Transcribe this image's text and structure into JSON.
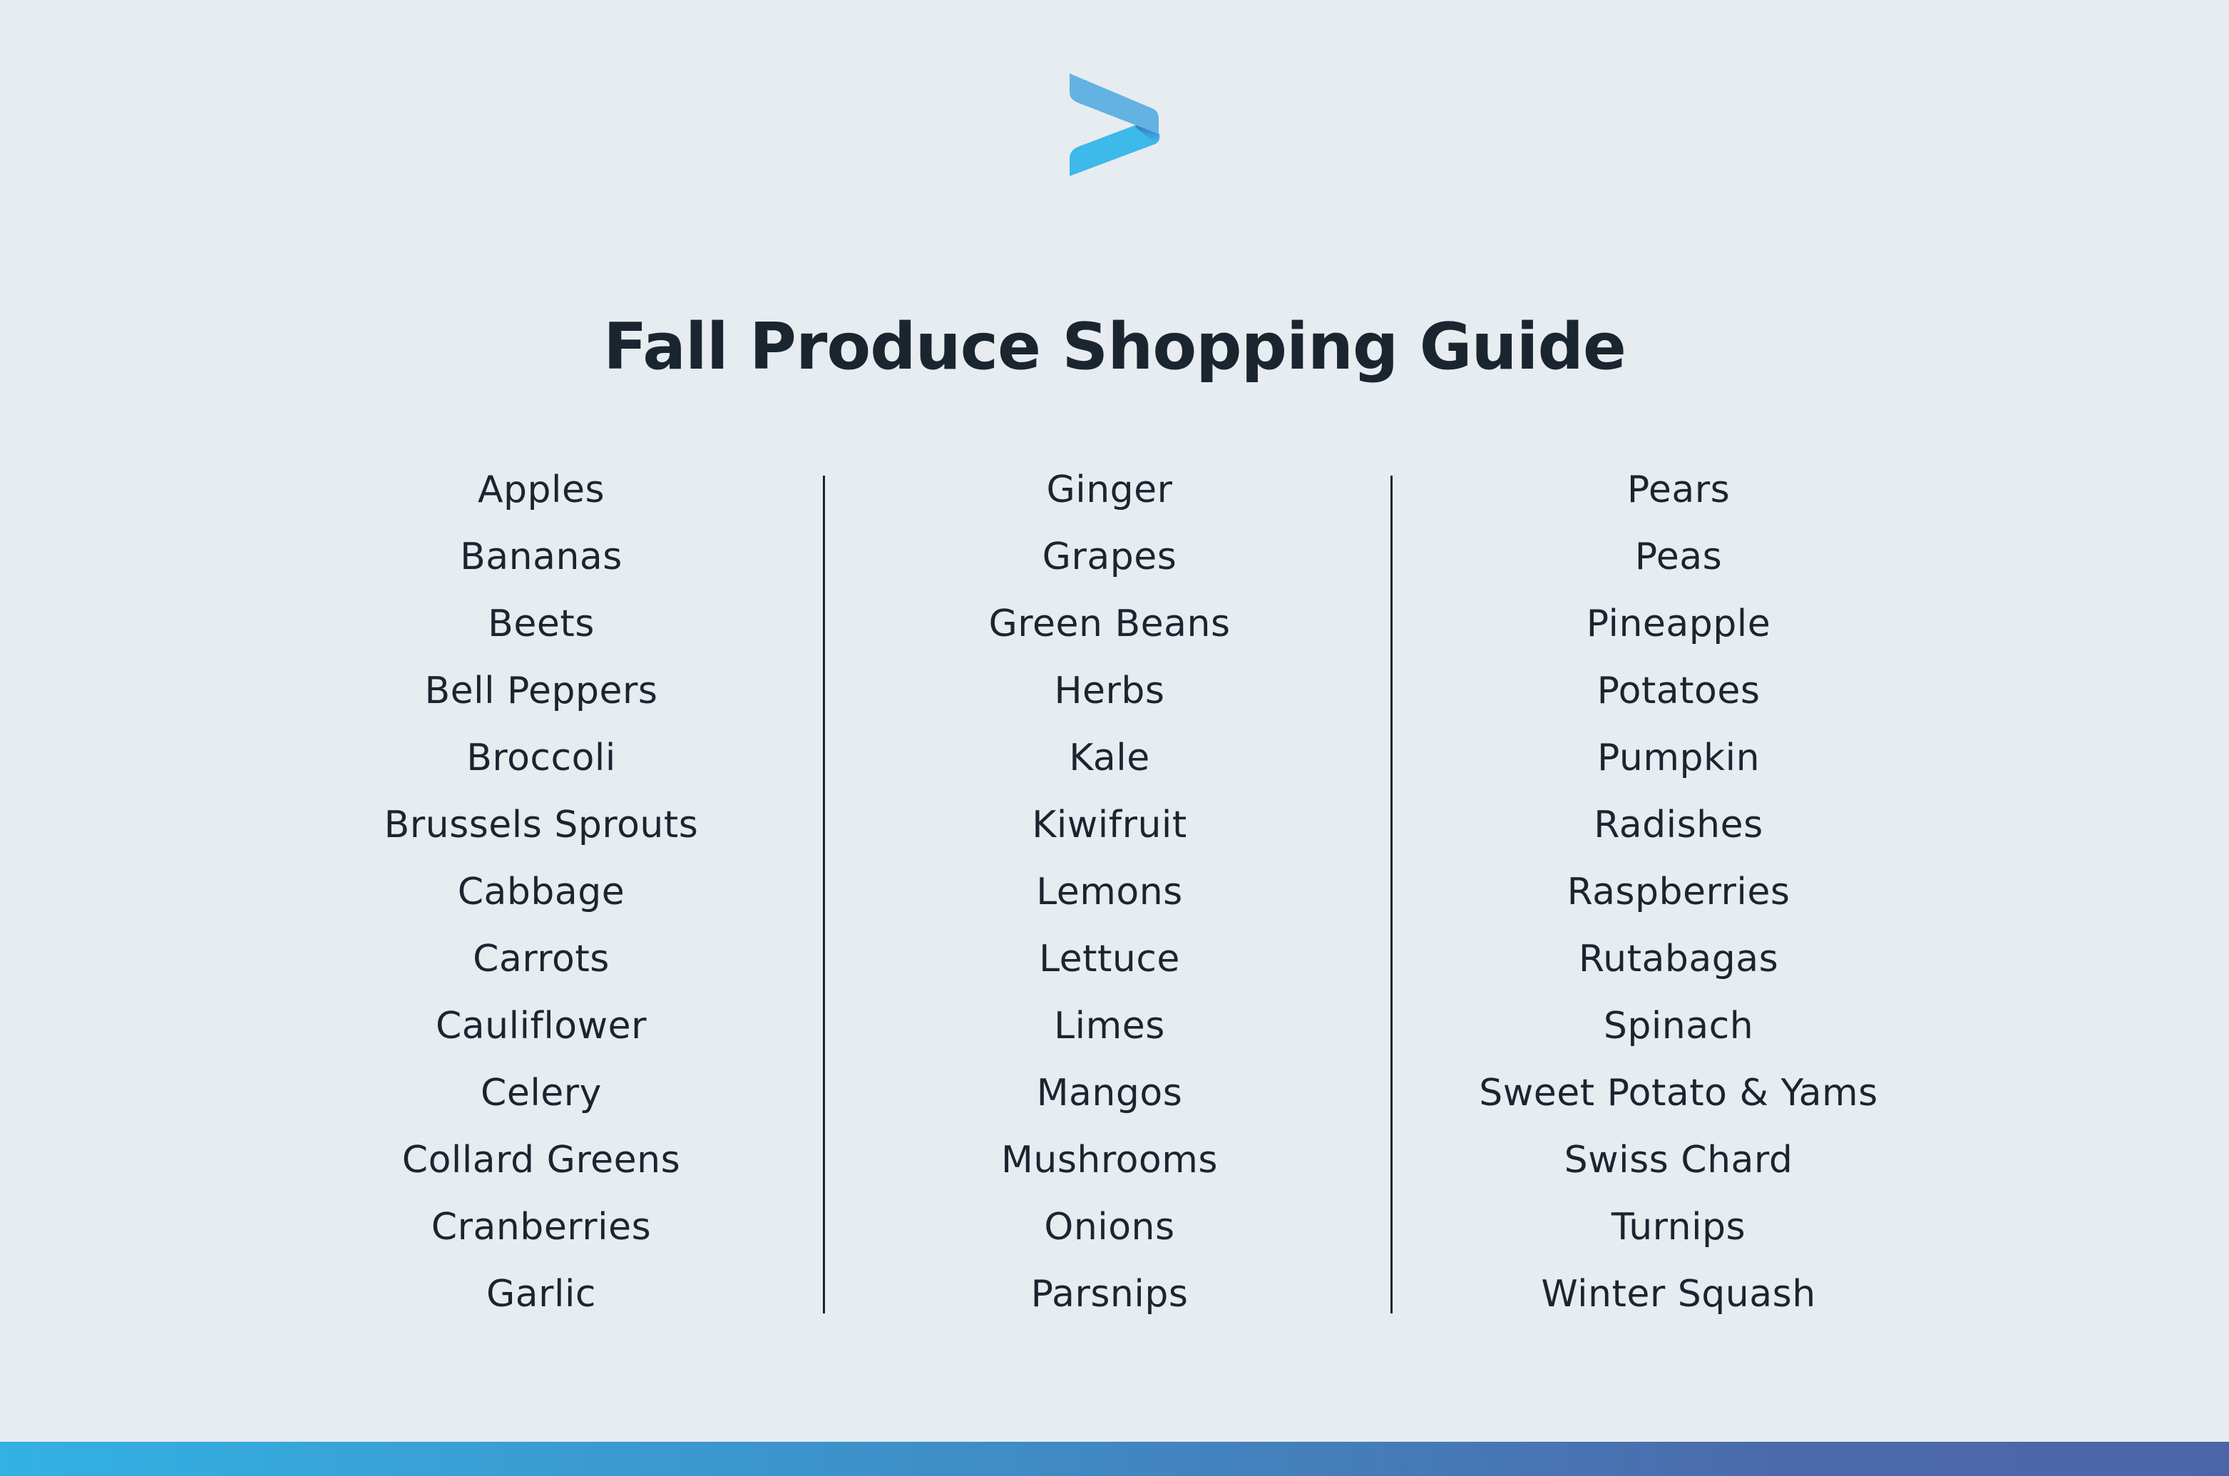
{
  "logo": {
    "icon": "chevron-right-brand-logo",
    "colors": {
      "upper": "#62b3e2",
      "lower": "#3db9ea",
      "fold": "#3a64b8"
    }
  },
  "title": "Fall Produce Shopping Guide",
  "columns": [
    [
      "Apples",
      "Bananas",
      "Beets",
      "Bell Peppers",
      "Broccoli",
      "Brussels Sprouts",
      "Cabbage",
      "Carrots",
      "Cauliflower",
      "Celery",
      "Collard Greens",
      "Cranberries",
      "Garlic"
    ],
    [
      "Ginger",
      "Grapes",
      "Green Beans",
      "Herbs",
      "Kale",
      "Kiwifruit",
      "Lemons",
      "Lettuce",
      "Limes",
      "Mangos",
      "Mushrooms",
      "Onions",
      "Parsnips"
    ],
    [
      "Pears",
      "Peas",
      "Pineapple",
      "Potatoes",
      "Pumpkin",
      "Radishes",
      "Raspberries",
      "Rutabagas",
      "Spinach",
      "Sweet Potato & Yams",
      "Swiss Chard",
      "Turnips",
      "Winter Squash"
    ]
  ],
  "colors": {
    "background": "#e7ecf0",
    "text": "#1b2530",
    "bar_start": "#33b1e3",
    "bar_end": "#4c65a7"
  }
}
